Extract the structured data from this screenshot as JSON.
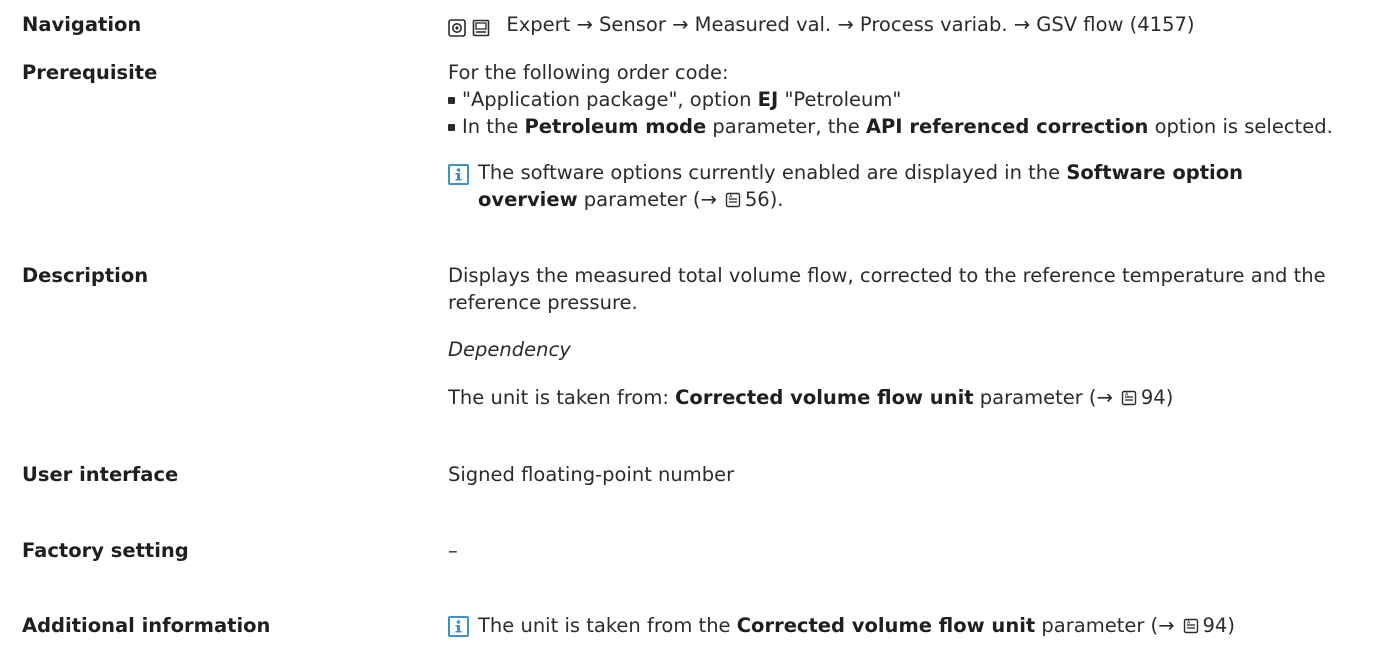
{
  "navigation": {
    "label": "Navigation",
    "path": "Expert → Sensor → Measured val. → Process variab. → GSV flow (4157)"
  },
  "prerequisite": {
    "label": "Prerequisite",
    "intro": "For the following order code:",
    "bullet1_pre": "\"Application package\", option ",
    "bullet1_bold": "EJ",
    "bullet1_post": " \"Petroleum\"",
    "bullet2_pre": "In the ",
    "bullet2_bold1": "Petroleum mode",
    "bullet2_mid": " parameter, the ",
    "bullet2_bold2": "API referenced correction",
    "bullet2_post": " option is selected.",
    "note_line1_pre": "The software options currently enabled are displayed in the ",
    "note_line1_bold": "Software option",
    "note_line2_bold": "overview",
    "note_line2_post": " parameter (→",
    "note_ref": "56).",
    "icon": "info-icon"
  },
  "description": {
    "label": "Description",
    "line1": "Displays the measured total volume flow, corrected to the reference temperature and the",
    "line2": "reference pressure.",
    "dependency_heading": "Dependency",
    "dep_pre": "The unit is taken from: ",
    "dep_bold": "Corrected volume flow unit",
    "dep_post": " parameter (→",
    "dep_ref": "94)"
  },
  "user_interface": {
    "label": "User interface",
    "value": "Signed floating-point number"
  },
  "factory_setting": {
    "label": "Factory setting",
    "value": "–"
  },
  "additional_information": {
    "label": "Additional information",
    "pre": "The unit is taken from the ",
    "bold": "Corrected volume flow unit",
    "post": " parameter (→",
    "ref": "94)"
  },
  "colors": {
    "text": "#2b2b2b",
    "info_icon": "#3f8fcb"
  }
}
